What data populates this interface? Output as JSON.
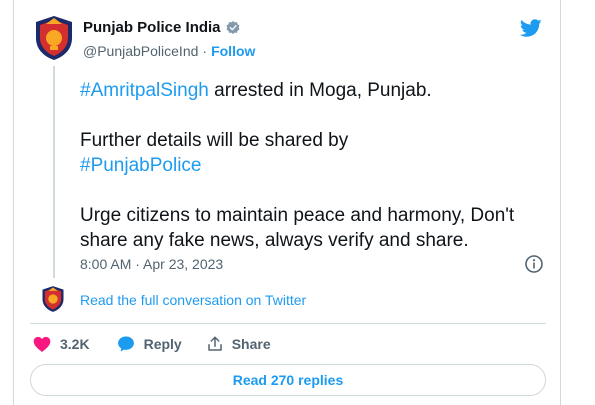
{
  "author": {
    "name": "Punjab Police India",
    "handle": "@PunjabPoliceInd",
    "separator": "·",
    "follow_label": "Follow",
    "verified_icon": "verified-badge-icon",
    "avatar_icon": "punjab-police-emblem"
  },
  "tweet": {
    "hashtag_1": "#AmritpalSingh",
    "line_1_rest": " arrested in Moga, Punjab.",
    "line_2_text": "Further details will be shared by",
    "hashtag_2": "#PunjabPolice",
    "line_3_text": "Urge citizens to maintain peace and harmony, Don't share any fake news, always verify and share."
  },
  "timestamp": "8:00 AM · Apr 23, 2023",
  "conversation": {
    "read_full_label": "Read the full conversation on Twitter"
  },
  "actions": {
    "likes_count": "3.2K",
    "reply_label": "Reply",
    "share_label": "Share"
  },
  "read_replies_label": "Read 270 replies",
  "colors": {
    "accent": "#1d9bf0",
    "like": "#f91880",
    "text": "#0f1419",
    "muted": "#536471",
    "border": "#cfd9de"
  }
}
